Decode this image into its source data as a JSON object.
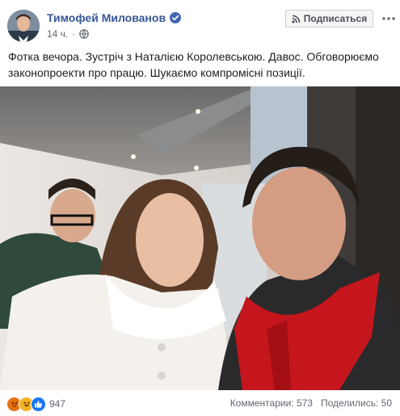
{
  "post": {
    "author": "Тимофей Милованов",
    "time": "14 ч.",
    "subscribe_label": "Подписаться",
    "text": "Фотка вечора. Зустріч з Наталією Королевською. Давос. Обговорюємо законопроекти про працю. Шукаємо компромісні позиції."
  },
  "footer": {
    "reaction_count": "947",
    "comments_label": "Комментарии",
    "comments_count": "573",
    "shares_label": "Поделились",
    "shares_count": "50",
    "reactions": [
      "angry-icon",
      "haha-icon",
      "like-icon"
    ]
  },
  "colors": {
    "link_blue": "#385898",
    "verified_blue": "#4267b2",
    "meta_gray": "#616770",
    "angry": "#e9710f",
    "haha": "#f7b125",
    "like": "#1877f2"
  }
}
